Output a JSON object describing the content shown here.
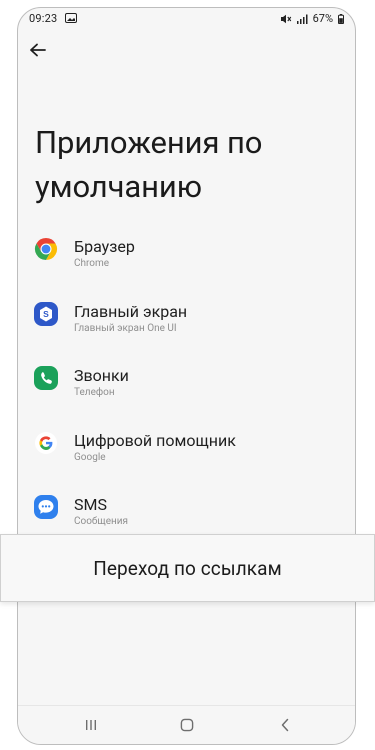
{
  "status_bar": {
    "time": "09:23",
    "battery": "67%",
    "icons": [
      "photo-icon",
      "mute-icon",
      "signal-icon",
      "battery-icon"
    ]
  },
  "header": {
    "back_icon": "arrow-left-icon",
    "title": "Приложения по умолчанию"
  },
  "apps": [
    {
      "title": "Браузер",
      "subtitle": "Chrome",
      "icon": "chrome-icon"
    },
    {
      "title": "Главный экран",
      "subtitle": "Главный экран One UI",
      "icon": "one-ui-home-icon"
    },
    {
      "title": "Звонки",
      "subtitle": "Телефон",
      "icon": "phone-icon"
    },
    {
      "title": "Цифровой помощник",
      "subtitle": "Google",
      "icon": "google-icon"
    },
    {
      "title": "SMS",
      "subtitle": "Сообщения",
      "icon": "messages-icon"
    }
  ],
  "overlay": {
    "label": "Переход по ссылкам"
  },
  "nav_bar": {
    "icons": [
      "recent-apps-icon",
      "home-icon",
      "back-icon"
    ]
  },
  "colors": {
    "background": "#f6f6f6",
    "one_ui_blue": "#2e58c8",
    "phone_green": "#1ba15a",
    "messages_blue": "#2f80ed"
  }
}
